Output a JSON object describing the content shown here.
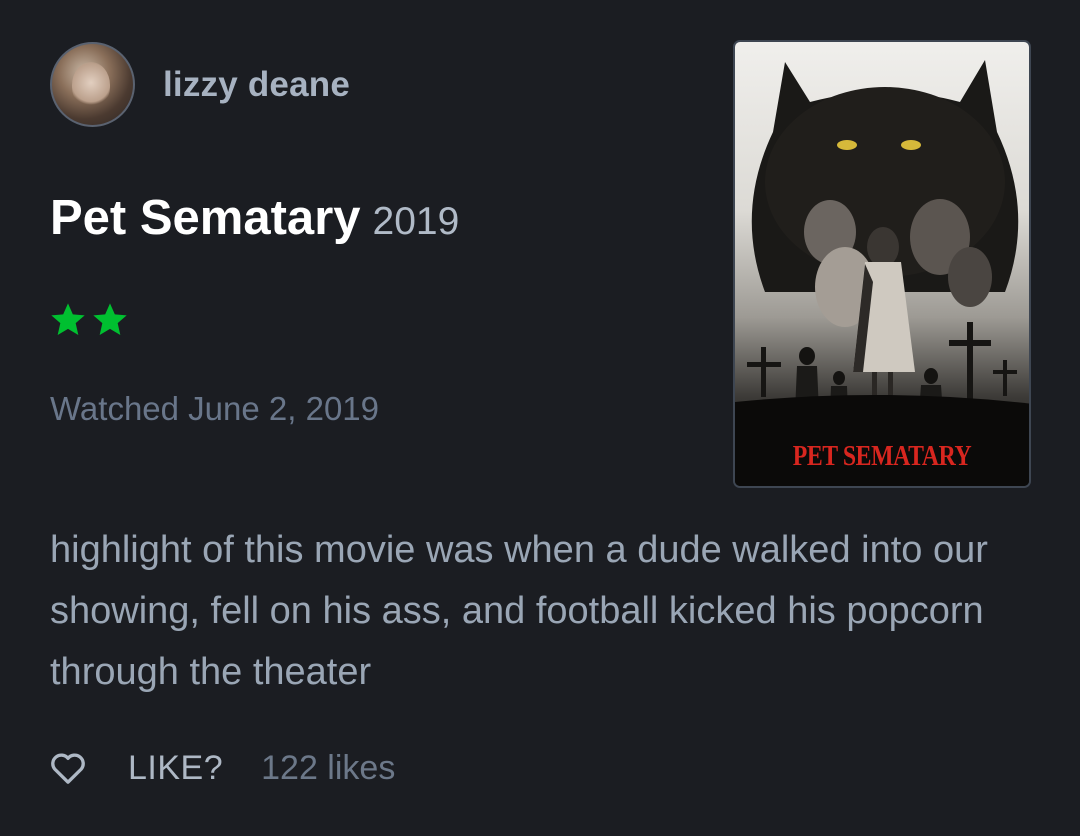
{
  "user": {
    "name": "lizzy deane"
  },
  "film": {
    "title": "Pet Sematary",
    "year": "2019"
  },
  "rating": {
    "stars": 2,
    "color": "#00c030"
  },
  "watched": "Watched June 2, 2019",
  "poster": {
    "title": "PET SEMATARY"
  },
  "review": {
    "text": "highlight of this movie was when a dude walked into our showing, fell on his ass, and football kicked his popcorn through the theater"
  },
  "footer": {
    "like_label": "LIKE?",
    "likes": "122 likes"
  },
  "icons": {
    "like": "heart-outline-icon",
    "star": "star-icon"
  }
}
